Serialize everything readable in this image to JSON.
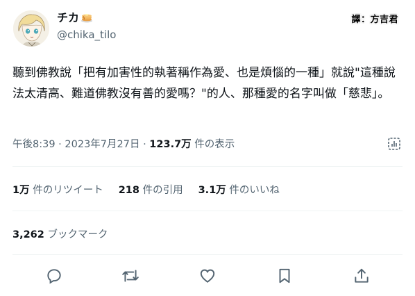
{
  "user": {
    "display_name": "チカ",
    "handle": "@chika_tilo"
  },
  "watermark": "譯：方吉君",
  "tweet": {
    "text": "聽到佛教說「把有加害性的執著稱作為愛、也是煩惱的一種」就說\"這種說法太清高、難道佛教沒有善的愛嗎？\"的人、那種愛的名字叫做「慈悲」。"
  },
  "meta": {
    "time": "午後8:39",
    "date": "2023年7月27日",
    "views": "123.7万",
    "views_label": "件の表示"
  },
  "stats": {
    "retweets": "1万",
    "retweets_label": "件のリツイート",
    "quotes": "218",
    "quotes_label": "件の引用",
    "likes": "3.1万",
    "likes_label": "件のいいね"
  },
  "bookmarks": {
    "count": "3,262",
    "label": "ブックマーク"
  },
  "actions": [
    {
      "icon": "reply-icon"
    },
    {
      "icon": "retweet-icon"
    },
    {
      "icon": "like-icon"
    },
    {
      "icon": "bookmark-icon"
    },
    {
      "icon": "share-icon"
    }
  ],
  "colors": {
    "text": "#0f1419",
    "secondary": "#536471",
    "divider": "#eff3f4"
  }
}
